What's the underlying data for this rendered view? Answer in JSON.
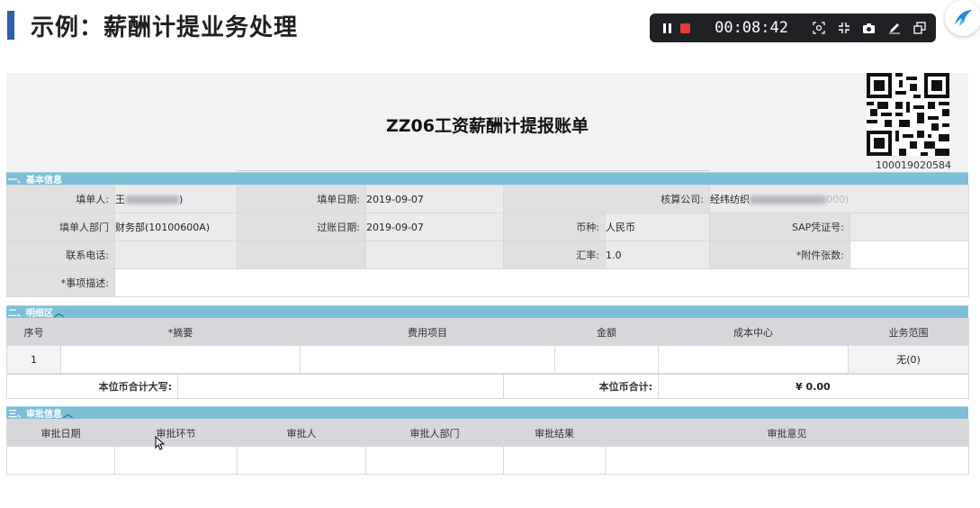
{
  "slide": {
    "title": "示例：薪酬计提业务处理"
  },
  "recorder": {
    "time": "00:08:42",
    "tools": [
      "focus-icon",
      "collapse-icon",
      "camera-icon",
      "pen-icon",
      "window-icon"
    ]
  },
  "document": {
    "title": "ZZ06工资薪酬计提报账单",
    "qr_number": "100019020584"
  },
  "basic_info": {
    "section_title": "一、基本信息",
    "filler_label": "填单人:",
    "filler_value": "王",
    "filler_value_tail": ")",
    "fill_date_label": "填单日期:",
    "fill_date_value": "2019-09-07",
    "company_label": "核算公司:",
    "company_value": "经纬纺织",
    "company_tail": "000)",
    "dept_label": "填单人部门",
    "dept_value": "财务部(10100600A)",
    "post_date_label": "过账日期:",
    "post_date_value": "2019-09-07",
    "currency_label": "币种:",
    "currency_value": "人民币",
    "sap_label": "SAP凭证号:",
    "sap_value": "",
    "phone_label": "联系电话:",
    "phone_value": "",
    "rate_label": "汇率:",
    "rate_value": "1.0",
    "attach_label": "*附件张数:",
    "attach_value": "",
    "desc_label": "*事项描述:",
    "desc_value": ""
  },
  "detail": {
    "section_title": "二、明细区",
    "columns": [
      "序号",
      "*摘要",
      "费用项目",
      "金额",
      "成本中心",
      "业务范围"
    ],
    "rows": [
      {
        "no": "1",
        "summary": "",
        "expense": "",
        "amount": "",
        "cost_center": "",
        "scope": "无(0)"
      }
    ],
    "total_words_label": "本位币合计大写:",
    "total_words_value": "",
    "total_label": "本位币合计:",
    "total_value": "¥ 0.00"
  },
  "approval": {
    "section_title": "三、审批信息",
    "columns": [
      "审批日期",
      "审批环节",
      "审批人",
      "审批人部门",
      "审批结果",
      "审批意见"
    ]
  }
}
